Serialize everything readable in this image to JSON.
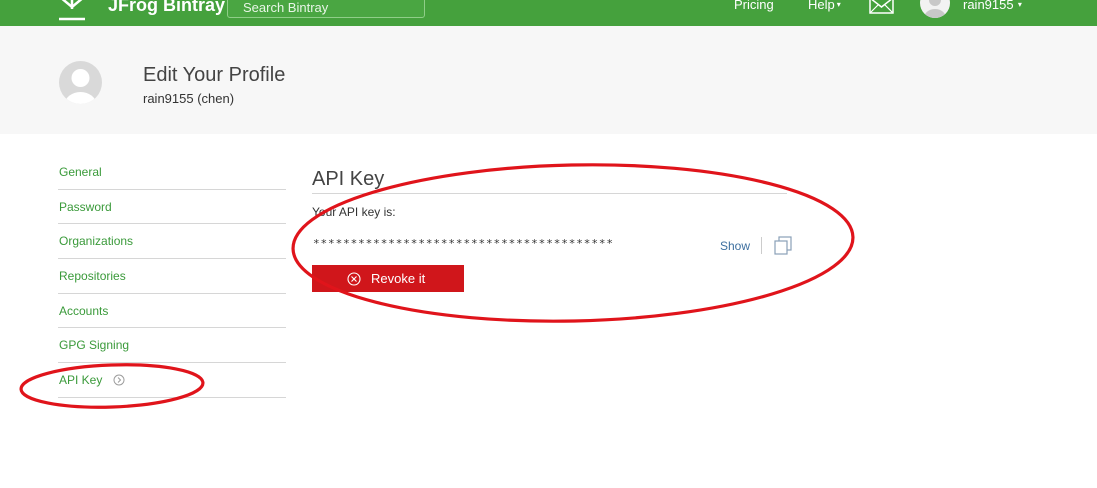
{
  "header": {
    "brand": "JFrog Bintray",
    "search_placeholder": "Search Bintray",
    "nav": {
      "pricing": "Pricing",
      "help": "Help"
    },
    "username": "rain9155",
    "colors": {
      "bar": "#45a13d"
    }
  },
  "profile": {
    "title": "Edit Your Profile",
    "subtitle": "rain9155 (chen)"
  },
  "sidebar": {
    "items": [
      {
        "label": "General"
      },
      {
        "label": "Password"
      },
      {
        "label": "Organizations"
      },
      {
        "label": "Repositories"
      },
      {
        "label": "Accounts"
      },
      {
        "label": "GPG Signing"
      },
      {
        "label": "API Key",
        "active": true
      }
    ]
  },
  "api": {
    "title": "API Key",
    "label": "Your API key is:",
    "masked_key": "****************************************",
    "show_label": "Show",
    "revoke_label": "Revoke it",
    "colors": {
      "revoke": "#d0161b",
      "annotation": "#e0141b"
    }
  }
}
